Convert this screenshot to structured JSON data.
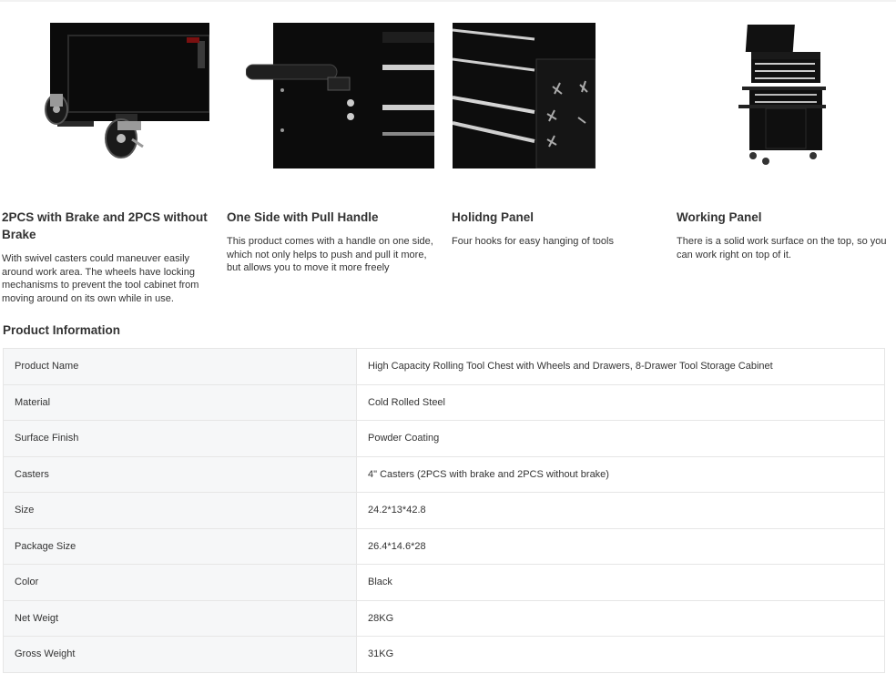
{
  "features": [
    {
      "title": "2PCS with Brake and 2PCS without Brake",
      "desc": "With swivel casters could maneuver easily around work area. The wheels have locking mechanisms to prevent the tool cabinet from moving around on its own while in use.",
      "image_icon": "caster-wheel-image"
    },
    {
      "title": "One Side with Pull Handle",
      "desc": "This product comes with a handle on one side, which not only helps to push and pull it more, but allows you to move it more freely",
      "image_icon": "pull-handle-image"
    },
    {
      "title": "Holidng Panel",
      "desc": "Four hooks for easy hanging of tools",
      "image_icon": "hooks-panel-image"
    },
    {
      "title": "Working Panel",
      "desc": "There is a solid work surface on the top, so you can work right on top of it.",
      "image_icon": "tool-chest-image"
    }
  ],
  "product_info": {
    "title": "Product Information",
    "rows": [
      {
        "label": "Product Name",
        "value": "High Capacity Rolling Tool Chest with Wheels and Drawers, 8-Drawer Tool Storage Cabinet"
      },
      {
        "label": "Material",
        "value": "Cold Rolled Steel"
      },
      {
        "label": "Surface Finish",
        "value": "Powder Coating"
      },
      {
        "label": "Casters",
        "value": "4\" Casters (2PCS with brake and 2PCS without brake)"
      },
      {
        "label": "Size",
        "value": "24.2*13*42.8"
      },
      {
        "label": "Package Size",
        "value": "26.4*14.6*28"
      },
      {
        "label": "Color",
        "value": "Black"
      },
      {
        "label": "Net Weigt",
        "value": "28KG"
      },
      {
        "label": "Gross Weight",
        "value": "31KG"
      }
    ]
  },
  "colors": {
    "label_bg": "#f6f7f8",
    "border": "#e6e6e6",
    "text": "#333333",
    "cabinet": "#111111"
  }
}
